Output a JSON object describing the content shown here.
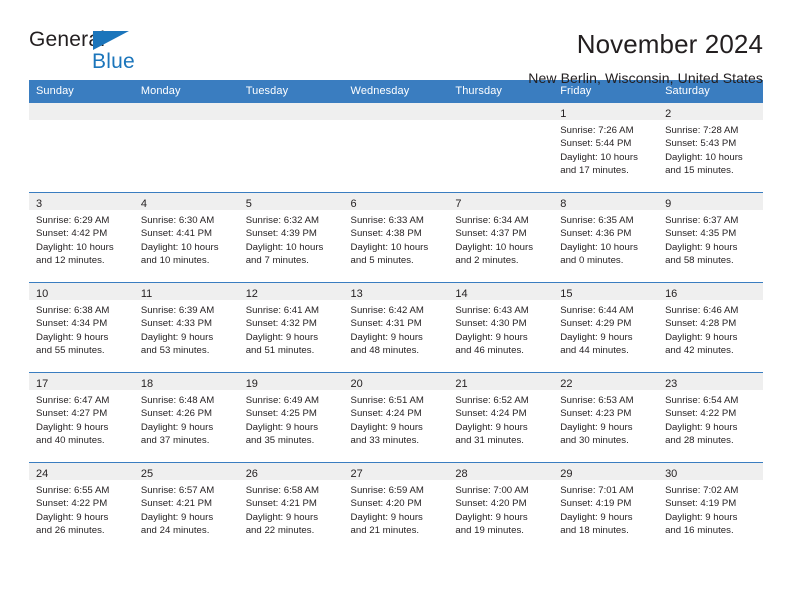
{
  "brand": {
    "name_part1": "General",
    "name_part2": "Blue",
    "accent_color": "#1b75bb",
    "triangle_icon": "brand-triangle-icon"
  },
  "header": {
    "title": "November 2024",
    "subtitle": "New Berlin, Wisconsin, United States"
  },
  "calendar": {
    "header_bg": "#3a7dc0",
    "daynum_bg": "#efefef",
    "weekdays": [
      "Sunday",
      "Monday",
      "Tuesday",
      "Wednesday",
      "Thursday",
      "Friday",
      "Saturday"
    ],
    "weeks": [
      [
        {
          "day": "",
          "empty": true,
          "lines": []
        },
        {
          "day": "",
          "empty": true,
          "lines": []
        },
        {
          "day": "",
          "empty": true,
          "lines": []
        },
        {
          "day": "",
          "empty": true,
          "lines": []
        },
        {
          "day": "",
          "empty": true,
          "lines": []
        },
        {
          "day": "1",
          "empty": false,
          "lines": [
            "Sunrise: 7:26 AM",
            "Sunset: 5:44 PM",
            "Daylight: 10 hours",
            "and 17 minutes."
          ]
        },
        {
          "day": "2",
          "empty": false,
          "lines": [
            "Sunrise: 7:28 AM",
            "Sunset: 5:43 PM",
            "Daylight: 10 hours",
            "and 15 minutes."
          ]
        }
      ],
      [
        {
          "day": "3",
          "empty": false,
          "lines": [
            "Sunrise: 6:29 AM",
            "Sunset: 4:42 PM",
            "Daylight: 10 hours",
            "and 12 minutes."
          ]
        },
        {
          "day": "4",
          "empty": false,
          "lines": [
            "Sunrise: 6:30 AM",
            "Sunset: 4:41 PM",
            "Daylight: 10 hours",
            "and 10 minutes."
          ]
        },
        {
          "day": "5",
          "empty": false,
          "lines": [
            "Sunrise: 6:32 AM",
            "Sunset: 4:39 PM",
            "Daylight: 10 hours",
            "and 7 minutes."
          ]
        },
        {
          "day": "6",
          "empty": false,
          "lines": [
            "Sunrise: 6:33 AM",
            "Sunset: 4:38 PM",
            "Daylight: 10 hours",
            "and 5 minutes."
          ]
        },
        {
          "day": "7",
          "empty": false,
          "lines": [
            "Sunrise: 6:34 AM",
            "Sunset: 4:37 PM",
            "Daylight: 10 hours",
            "and 2 minutes."
          ]
        },
        {
          "day": "8",
          "empty": false,
          "lines": [
            "Sunrise: 6:35 AM",
            "Sunset: 4:36 PM",
            "Daylight: 10 hours",
            "and 0 minutes."
          ]
        },
        {
          "day": "9",
          "empty": false,
          "lines": [
            "Sunrise: 6:37 AM",
            "Sunset: 4:35 PM",
            "Daylight: 9 hours",
            "and 58 minutes."
          ]
        }
      ],
      [
        {
          "day": "10",
          "empty": false,
          "lines": [
            "Sunrise: 6:38 AM",
            "Sunset: 4:34 PM",
            "Daylight: 9 hours",
            "and 55 minutes."
          ]
        },
        {
          "day": "11",
          "empty": false,
          "lines": [
            "Sunrise: 6:39 AM",
            "Sunset: 4:33 PM",
            "Daylight: 9 hours",
            "and 53 minutes."
          ]
        },
        {
          "day": "12",
          "empty": false,
          "lines": [
            "Sunrise: 6:41 AM",
            "Sunset: 4:32 PM",
            "Daylight: 9 hours",
            "and 51 minutes."
          ]
        },
        {
          "day": "13",
          "empty": false,
          "lines": [
            "Sunrise: 6:42 AM",
            "Sunset: 4:31 PM",
            "Daylight: 9 hours",
            "and 48 minutes."
          ]
        },
        {
          "day": "14",
          "empty": false,
          "lines": [
            "Sunrise: 6:43 AM",
            "Sunset: 4:30 PM",
            "Daylight: 9 hours",
            "and 46 minutes."
          ]
        },
        {
          "day": "15",
          "empty": false,
          "lines": [
            "Sunrise: 6:44 AM",
            "Sunset: 4:29 PM",
            "Daylight: 9 hours",
            "and 44 minutes."
          ]
        },
        {
          "day": "16",
          "empty": false,
          "lines": [
            "Sunrise: 6:46 AM",
            "Sunset: 4:28 PM",
            "Daylight: 9 hours",
            "and 42 minutes."
          ]
        }
      ],
      [
        {
          "day": "17",
          "empty": false,
          "lines": [
            "Sunrise: 6:47 AM",
            "Sunset: 4:27 PM",
            "Daylight: 9 hours",
            "and 40 minutes."
          ]
        },
        {
          "day": "18",
          "empty": false,
          "lines": [
            "Sunrise: 6:48 AM",
            "Sunset: 4:26 PM",
            "Daylight: 9 hours",
            "and 37 minutes."
          ]
        },
        {
          "day": "19",
          "empty": false,
          "lines": [
            "Sunrise: 6:49 AM",
            "Sunset: 4:25 PM",
            "Daylight: 9 hours",
            "and 35 minutes."
          ]
        },
        {
          "day": "20",
          "empty": false,
          "lines": [
            "Sunrise: 6:51 AM",
            "Sunset: 4:24 PM",
            "Daylight: 9 hours",
            "and 33 minutes."
          ]
        },
        {
          "day": "21",
          "empty": false,
          "lines": [
            "Sunrise: 6:52 AM",
            "Sunset: 4:24 PM",
            "Daylight: 9 hours",
            "and 31 minutes."
          ]
        },
        {
          "day": "22",
          "empty": false,
          "lines": [
            "Sunrise: 6:53 AM",
            "Sunset: 4:23 PM",
            "Daylight: 9 hours",
            "and 30 minutes."
          ]
        },
        {
          "day": "23",
          "empty": false,
          "lines": [
            "Sunrise: 6:54 AM",
            "Sunset: 4:22 PM",
            "Daylight: 9 hours",
            "and 28 minutes."
          ]
        }
      ],
      [
        {
          "day": "24",
          "empty": false,
          "lines": [
            "Sunrise: 6:55 AM",
            "Sunset: 4:22 PM",
            "Daylight: 9 hours",
            "and 26 minutes."
          ]
        },
        {
          "day": "25",
          "empty": false,
          "lines": [
            "Sunrise: 6:57 AM",
            "Sunset: 4:21 PM",
            "Daylight: 9 hours",
            "and 24 minutes."
          ]
        },
        {
          "day": "26",
          "empty": false,
          "lines": [
            "Sunrise: 6:58 AM",
            "Sunset: 4:21 PM",
            "Daylight: 9 hours",
            "and 22 minutes."
          ]
        },
        {
          "day": "27",
          "empty": false,
          "lines": [
            "Sunrise: 6:59 AM",
            "Sunset: 4:20 PM",
            "Daylight: 9 hours",
            "and 21 minutes."
          ]
        },
        {
          "day": "28",
          "empty": false,
          "lines": [
            "Sunrise: 7:00 AM",
            "Sunset: 4:20 PM",
            "Daylight: 9 hours",
            "and 19 minutes."
          ]
        },
        {
          "day": "29",
          "empty": false,
          "lines": [
            "Sunrise: 7:01 AM",
            "Sunset: 4:19 PM",
            "Daylight: 9 hours",
            "and 18 minutes."
          ]
        },
        {
          "day": "30",
          "empty": false,
          "lines": [
            "Sunrise: 7:02 AM",
            "Sunset: 4:19 PM",
            "Daylight: 9 hours",
            "and 16 minutes."
          ]
        }
      ]
    ]
  }
}
